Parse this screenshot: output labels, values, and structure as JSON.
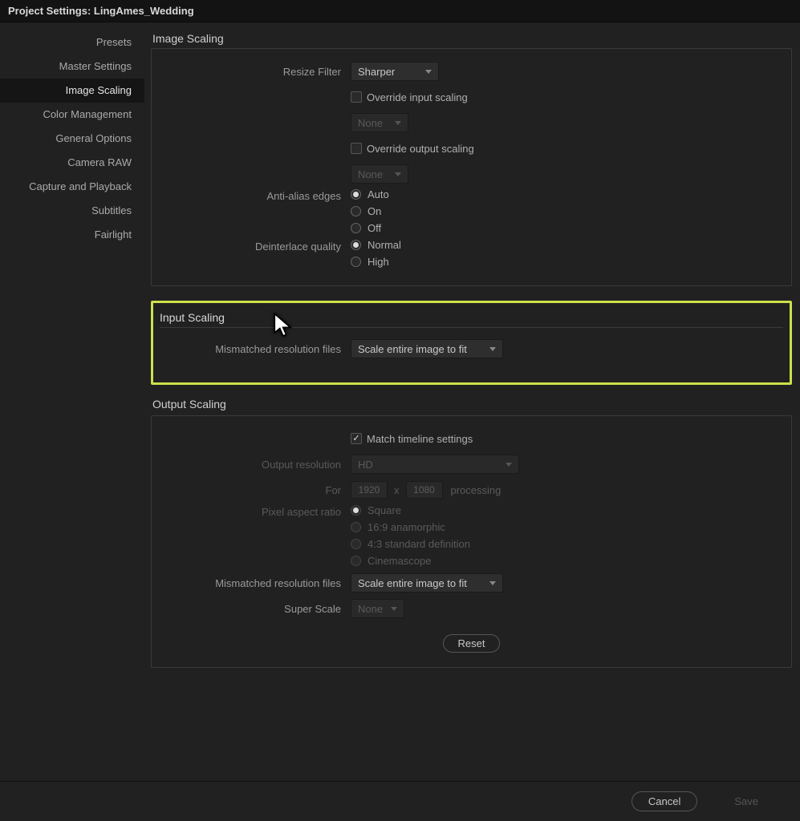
{
  "window": {
    "title_prefix": "Project Settings: ",
    "project_name": "LingAmes_Wedding"
  },
  "sidebar": {
    "items": [
      {
        "label": "Presets"
      },
      {
        "label": "Master Settings"
      },
      {
        "label": "Image Scaling",
        "selected": true
      },
      {
        "label": "Color Management"
      },
      {
        "label": "General Options"
      },
      {
        "label": "Camera RAW"
      },
      {
        "label": "Capture and Playback"
      },
      {
        "label": "Subtitles"
      },
      {
        "label": "Fairlight"
      }
    ]
  },
  "page": {
    "title": "Image Scaling"
  },
  "top_panel": {
    "resize_filter": {
      "label": "Resize Filter",
      "value": "Sharper"
    },
    "override_input": {
      "label": "Override input scaling",
      "checked": false,
      "dropdown": "None"
    },
    "override_output": {
      "label": "Override output scaling",
      "checked": false,
      "dropdown": "None"
    },
    "anti_alias": {
      "label": "Anti-alias edges",
      "options": [
        "Auto",
        "On",
        "Off"
      ],
      "selected": "Auto"
    },
    "deinterlace": {
      "label": "Deinterlace quality",
      "options": [
        "Normal",
        "High"
      ],
      "selected": "Normal"
    }
  },
  "input_scaling": {
    "header": "Input Scaling",
    "mismatched": {
      "label": "Mismatched resolution files",
      "value": "Scale entire image to fit"
    }
  },
  "output_scaling": {
    "header": "Output Scaling",
    "match_timeline": {
      "label": "Match timeline settings",
      "checked": true
    },
    "output_resolution": {
      "label": "Output resolution",
      "value": "HD"
    },
    "for": {
      "label": "For",
      "width": "1920",
      "height": "1080",
      "suffix": "processing"
    },
    "pixel_aspect": {
      "label": "Pixel aspect ratio",
      "options": [
        "Square",
        "16:9 anamorphic",
        "4:3 standard definition",
        "Cinemascope"
      ],
      "selected": "Square"
    },
    "mismatched": {
      "label": "Mismatched resolution files",
      "value": "Scale entire image to fit"
    },
    "super_scale": {
      "label": "Super Scale",
      "value": "None"
    },
    "reset": "Reset"
  },
  "footer": {
    "cancel": "Cancel",
    "save": "Save"
  }
}
